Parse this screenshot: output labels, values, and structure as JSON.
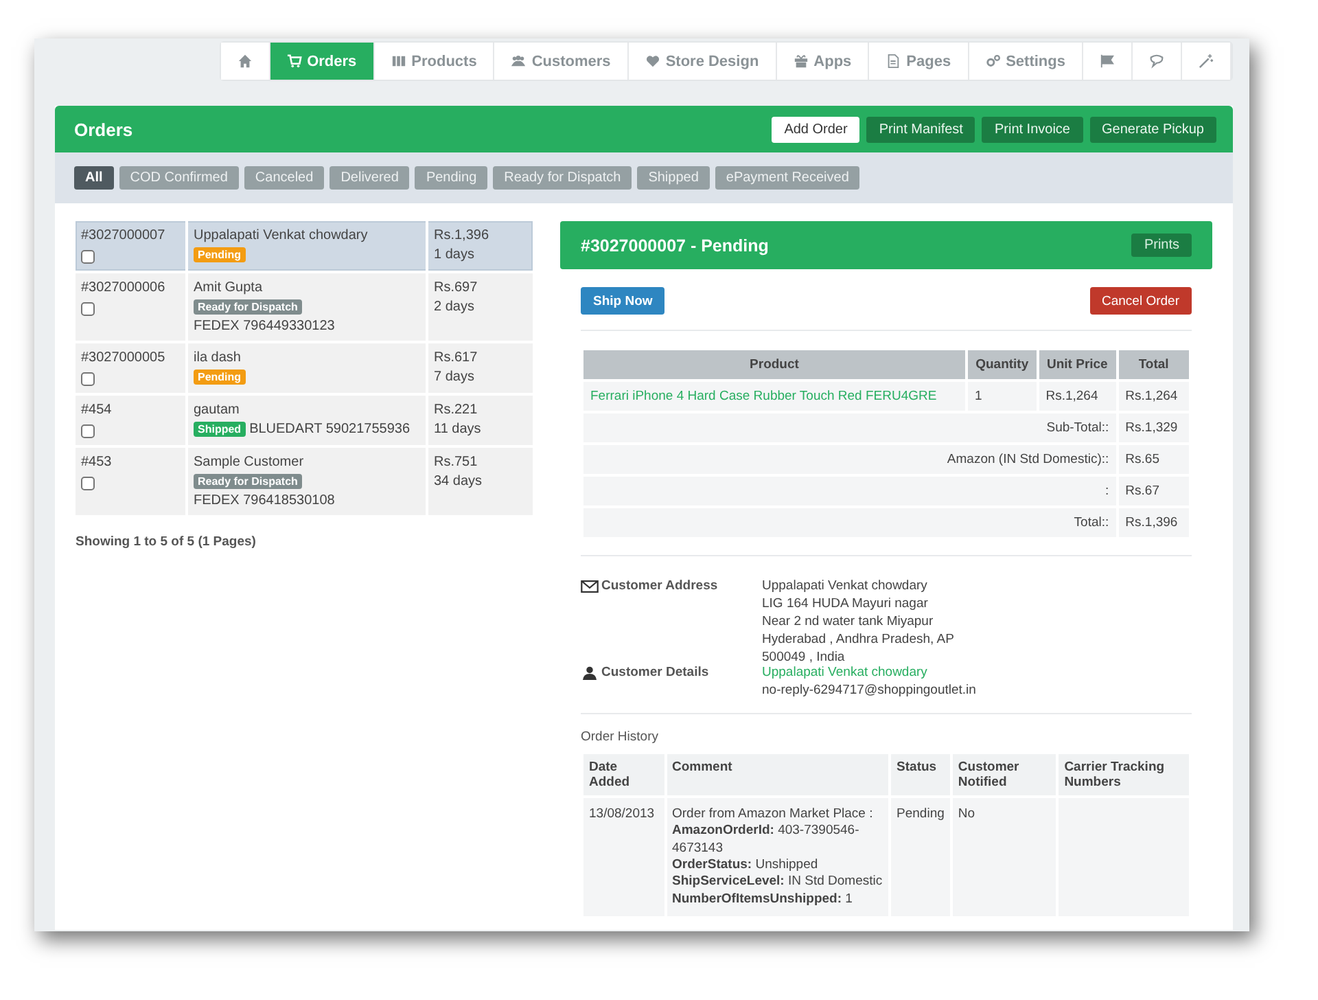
{
  "nav": [
    {
      "selected": false
    },
    {
      "label": "Orders",
      "selected": true
    },
    {
      "label": "Products",
      "selected": false
    },
    {
      "label": "Customers",
      "selected": false
    },
    {
      "label": "Store Design",
      "selected": false
    },
    {
      "label": "Apps",
      "selected": false
    },
    {
      "label": "Pages",
      "selected": false
    },
    {
      "label": "Settings",
      "selected": false
    },
    {
      "selected": false
    },
    {
      "selected": false
    },
    {
      "selected": false
    }
  ],
  "orders_panel": {
    "title": "Orders",
    "actions": [
      {
        "label": "Add Order",
        "kind": "light"
      },
      {
        "label": "Print Manifest",
        "kind": "dark"
      },
      {
        "label": "Print Invoice",
        "kind": "dark"
      },
      {
        "label": "Generate Pickup",
        "kind": "dark"
      }
    ]
  },
  "filters": [
    {
      "label": "All",
      "selected": true
    },
    {
      "label": "COD Confirmed",
      "selected": false
    },
    {
      "label": "Canceled",
      "selected": false
    },
    {
      "label": "Delivered",
      "selected": false
    },
    {
      "label": "Pending",
      "selected": false
    },
    {
      "label": "Ready for Dispatch",
      "selected": false
    },
    {
      "label": "Shipped",
      "selected": false
    },
    {
      "label": "ePayment Received",
      "selected": false
    }
  ],
  "order_list": [
    {
      "id": "#3027000007",
      "checked": false,
      "selected": true,
      "customer": "Uppalapati Venkat chowdary",
      "badge": {
        "label": "Pending",
        "color": "#f39c12"
      },
      "amount": "Rs.1,396",
      "age": "1 days"
    },
    {
      "id": "#3027000006",
      "checked": false,
      "selected": false,
      "customer": "Amit Gupta",
      "badge": {
        "label": "Ready for Dispatch",
        "color": "#7f8c8d"
      },
      "carrier": "FEDEX 796449330123",
      "amount": "Rs.697",
      "age": "2 days"
    },
    {
      "id": "#3027000005",
      "checked": false,
      "selected": false,
      "customer": "ila dash",
      "badge": {
        "label": "Pending",
        "color": "#f39c12"
      },
      "amount": "Rs.617",
      "age": "7 days"
    },
    {
      "id": "#454",
      "checked": false,
      "selected": false,
      "customer": "gautam",
      "badge": {
        "label": "Shipped",
        "color": "#27ae60"
      },
      "carrier": "BLUEDART 59021755936",
      "amount": "Rs.221",
      "age": "11 days"
    },
    {
      "id": "#453",
      "checked": false,
      "selected": false,
      "customer": "Sample Customer",
      "badge": {
        "label": "Ready for Dispatch",
        "color": "#7f8c8d"
      },
      "carrier": "FEDEX 796418530108",
      "amount": "Rs.751",
      "age": "34 days"
    }
  ],
  "list_pagination": "Showing 1 to 5 of 5 (1 Pages)",
  "detail": {
    "title": "#3027000007 - Pending",
    "prints_button": "Prints",
    "ship_button": "Ship Now",
    "cancel_button": "Cancel Order",
    "products": {
      "columns": [
        "Product",
        "Quantity",
        "Unit Price",
        "Total"
      ],
      "rows": [
        {
          "product": "Ferrari iPhone 4 Hard Case Rubber Touch Red FERU4GRE",
          "quantity": "1",
          "unit_price": "Rs.1,264",
          "total": "Rs.1,264"
        }
      ],
      "totals": [
        {
          "label": "Sub-Total::",
          "value": "Rs.1,329"
        },
        {
          "label": "Amazon (IN Std Domestic)::",
          "value": "Rs.65"
        },
        {
          "label": ":",
          "value": "Rs.67"
        },
        {
          "label": "Total::",
          "value": "Rs.1,396"
        }
      ]
    },
    "address_label": "Customer Address",
    "address_lines": [
      "Uppalapati Venkat chowdary",
      "LIG 164 HUDA Mayuri nagar",
      "Near 2 nd water tank Miyapur",
      "Hyderabad , Andhra Pradesh, AP",
      "500049 , India"
    ],
    "details_label": "Customer Details",
    "customer_name": "Uppalapati Venkat chowdary",
    "customer_email": "no-reply-6294717@shoppingoutlet.in",
    "history": {
      "title": "Order History",
      "columns": [
        "Date Added",
        "Comment",
        "Status",
        "Customer Notified",
        "Carrier Tracking Numbers"
      ],
      "rows": [
        {
          "date": "13/08/2013",
          "comment": [
            "Order from Amazon Market Place :",
            "**AmazonOrderId:** 403-7390546-4673143",
            "**OrderStatus:** Unshipped",
            "**ShipServiceLevel:** IN Std Domestic",
            "**NumberOfItemsUnshipped:** 1"
          ],
          "status": "Pending",
          "notified": "No"
        }
      ]
    }
  }
}
